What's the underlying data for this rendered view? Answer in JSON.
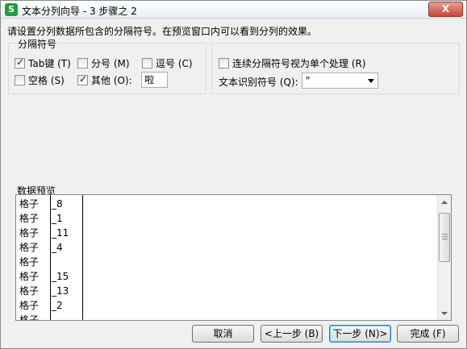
{
  "window": {
    "app_icon": "S",
    "title": "文本分列向导 - 3 步骤之 2",
    "close_label": "X"
  },
  "instruction": "请设置分列数据所包含的分隔符号。在预览窗口内可以看到分列的效果。",
  "delimiters": {
    "legend": "分隔符号",
    "tab": {
      "label": "Tab键 (T)",
      "checked": true
    },
    "semicolon": {
      "label": "分号 (M)",
      "checked": false
    },
    "comma": {
      "label": "逗号 (C)",
      "checked": false
    },
    "space": {
      "label": "空格 (S)",
      "checked": false
    },
    "other": {
      "label": "其他 (O):",
      "checked": true,
      "value": "啦"
    }
  },
  "options": {
    "consecutive": {
      "label": "连续分隔符号视为单个处理 (R)",
      "checked": false
    },
    "qualifier_label": "文本识别符号 (Q):",
    "qualifier_value": "\""
  },
  "preview": {
    "label": "数据预览",
    "col1": [
      "格子",
      "格子",
      "格子",
      "格子",
      "格子",
      "格子",
      "格子",
      "格子",
      "格子"
    ],
    "col2": [
      "_8",
      "_1",
      "_11",
      "_4",
      "",
      "_15",
      "_13",
      "_2",
      ""
    ]
  },
  "buttons": {
    "cancel": "取消",
    "back": "<上一步 (B)",
    "next": "下一步 (N)>",
    "finish": "完成 (F)"
  },
  "icons": {
    "close": "close-icon",
    "scroll_up": "scroll-up-icon",
    "scroll_down": "scroll-down-icon",
    "dropdown": "chevron-down-icon"
  }
}
